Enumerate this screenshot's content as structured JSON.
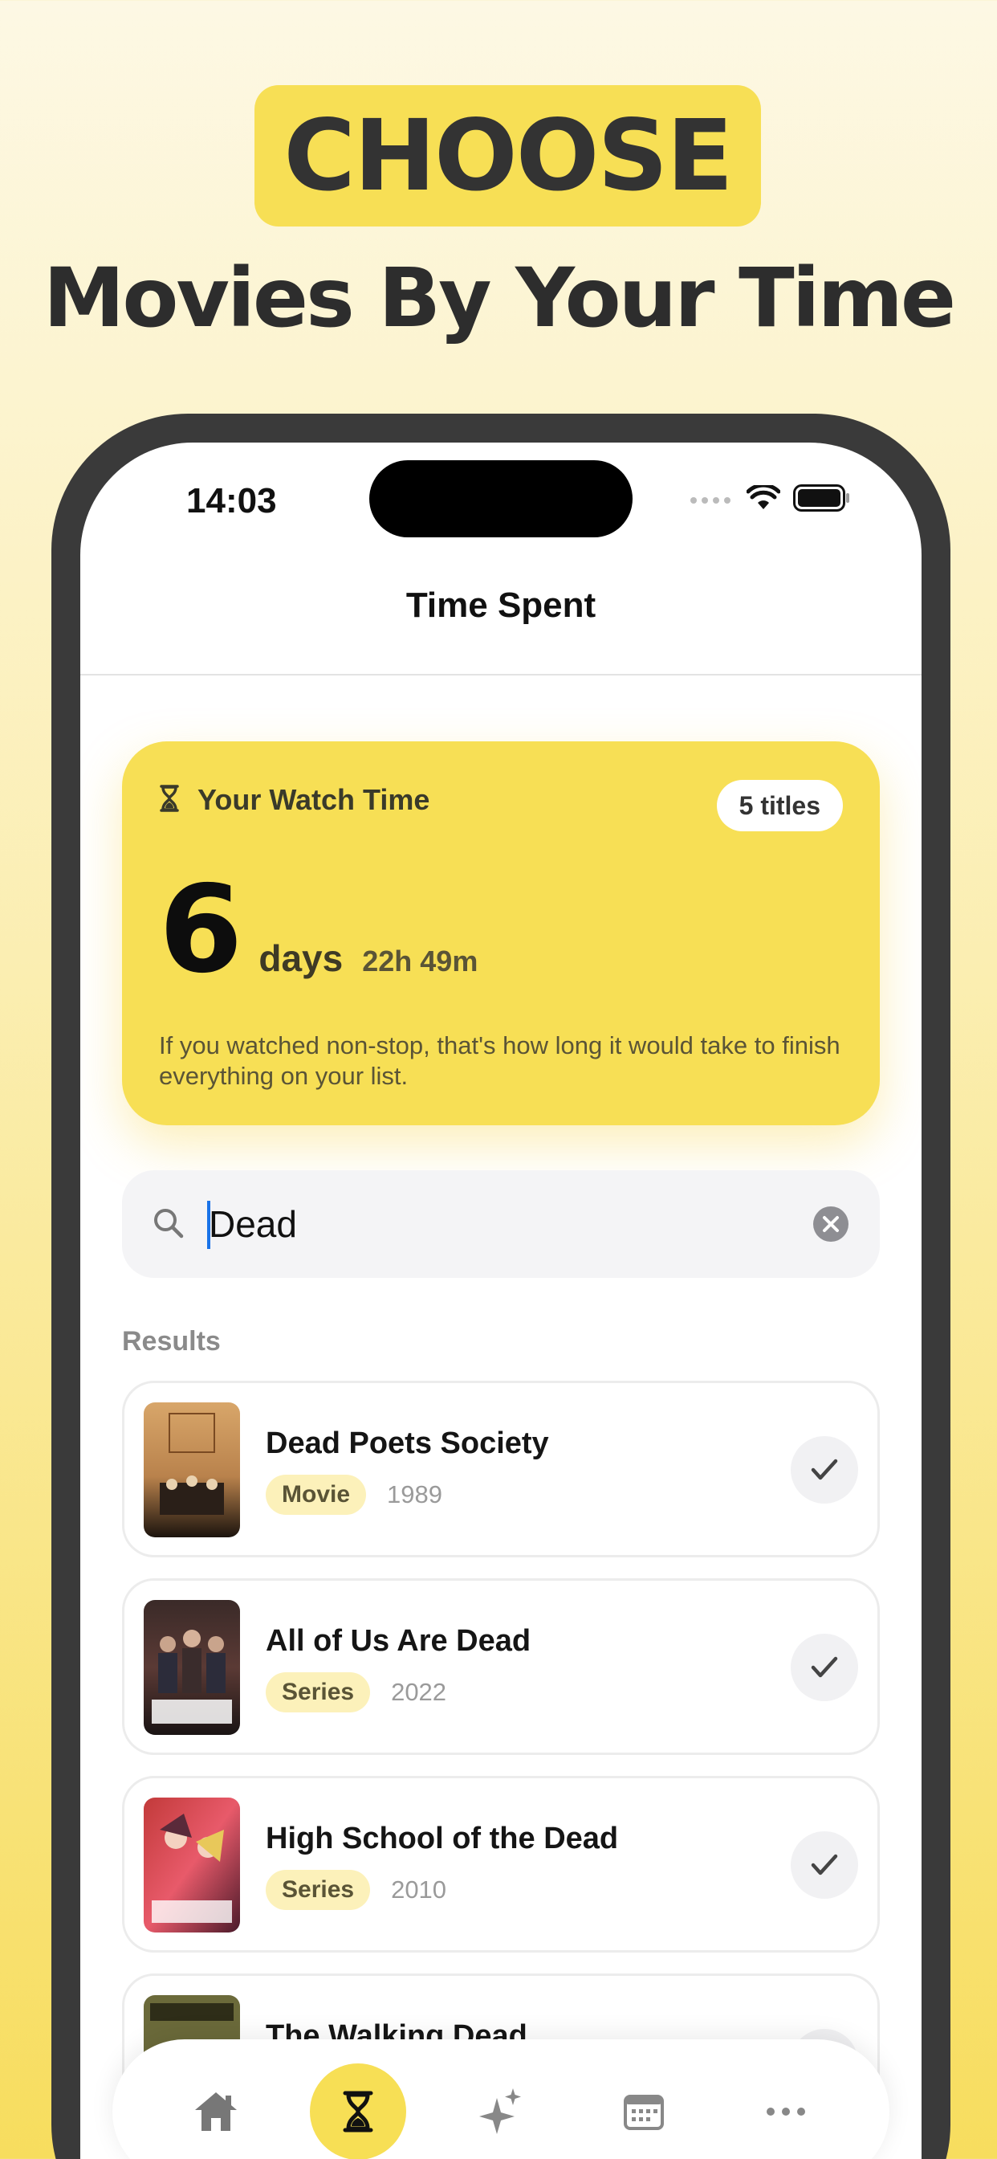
{
  "hero": {
    "badge": "CHOOSE",
    "subtitle": "Movies By Your Time"
  },
  "status_bar": {
    "time": "14:03"
  },
  "nav": {
    "title": "Time Spent"
  },
  "watch_card": {
    "label": "Your Watch Time",
    "titles_count": "5 titles",
    "days_number": "6",
    "days_unit": "days",
    "remainder": "22h 49m",
    "description": "If you watched non-stop, that's how long it would take to finish everything on your list."
  },
  "search": {
    "value": "Dead",
    "placeholder": ""
  },
  "results": {
    "label": "Results",
    "items": [
      {
        "title": "Dead Poets Society",
        "type": "Movie",
        "year": "1989",
        "poster": "dead-poets-society-poster"
      },
      {
        "title": "All of Us Are Dead",
        "type": "Series",
        "year": "2022",
        "poster": "all-of-us-are-dead-poster"
      },
      {
        "title": "High School of the Dead",
        "type": "Series",
        "year": "2010",
        "poster": "high-school-of-the-dead-poster"
      },
      {
        "title": "The Walking Dead",
        "type": "",
        "year": "",
        "poster": "the-walking-dead-poster"
      }
    ]
  },
  "tab_bar": {
    "tabs": [
      {
        "icon": "home-icon",
        "active": false
      },
      {
        "icon": "hourglass-icon",
        "active": true
      },
      {
        "icon": "sparkles-icon",
        "active": false
      },
      {
        "icon": "calendar-icon",
        "active": false
      },
      {
        "icon": "more-icon",
        "active": false
      }
    ]
  },
  "colors": {
    "accent": "#f7df55",
    "tag_bg": "#fcf1ba",
    "caret": "#1a73e8"
  }
}
